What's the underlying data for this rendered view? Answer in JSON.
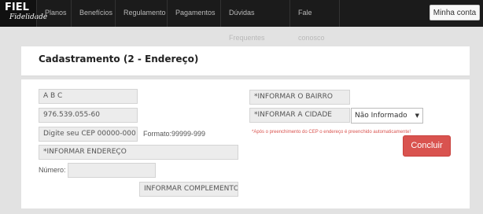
{
  "brand": {
    "name": "FIEL",
    "tagline": "Fidelidade"
  },
  "nav": {
    "items": [
      "Planos",
      "Benefícios",
      "Regulamento",
      "Pagamentos",
      "Dúvidas Frequentes",
      "Fale conosco"
    ],
    "account_label": "Minha conta"
  },
  "page": {
    "title": "Cadastramento (2 - Endereço)"
  },
  "form": {
    "name_value": "A B C",
    "cpf_value": "976.539.055-60",
    "cep_placeholder": "Digite seu CEP 00000-000",
    "cep_format": "Formato:99999-999",
    "address_placeholder": "*INFORMAR ENDEREÇO",
    "number_label": "Número:",
    "number_value": "",
    "complement_placeholder": "INFORMAR COMPLEMENTO",
    "district_placeholder": "*INFORMAR O BAIRRO",
    "city_placeholder": "*INFORMAR A CIDADE",
    "state_selected": "Não Informado",
    "cep_note": "*Após o preenchimento do CEP o endereço é preenchido automaticamente!",
    "submit_label": "Concluir"
  },
  "colors": {
    "nav_bg": "#1b1b1b",
    "accent": "#d9534f",
    "page_bg": "#e2e2e2"
  }
}
